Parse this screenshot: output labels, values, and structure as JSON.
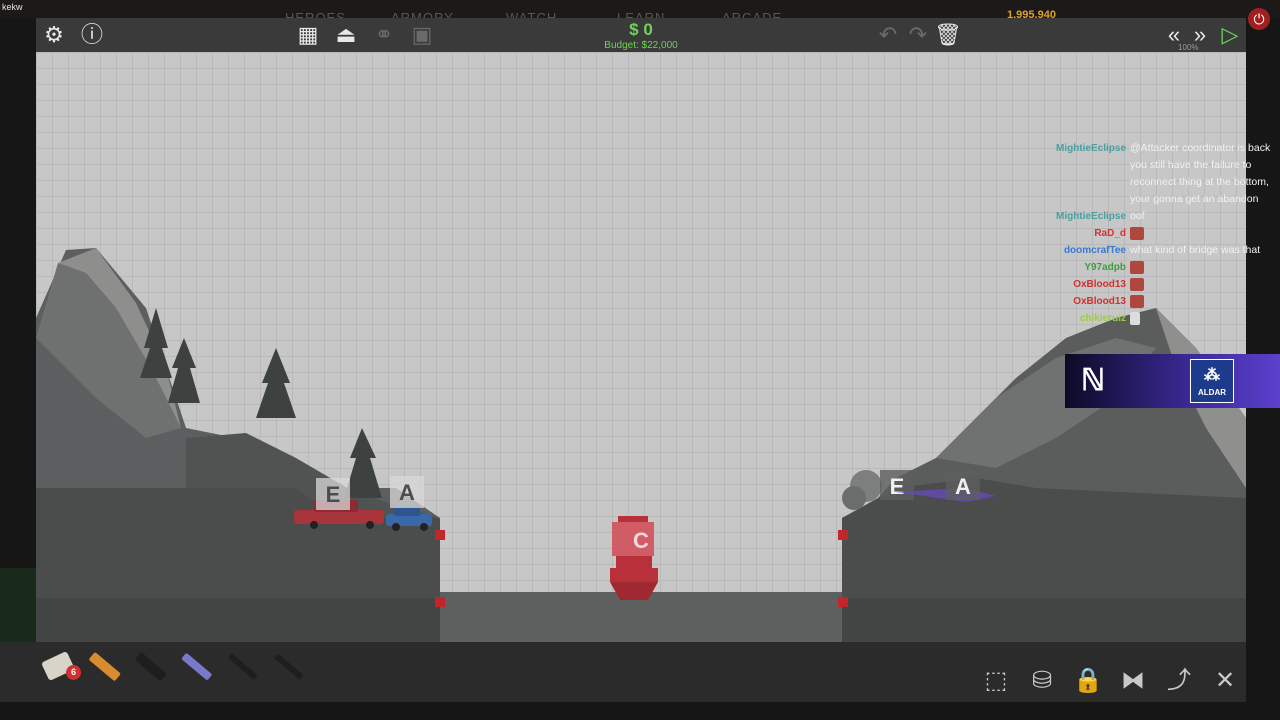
{
  "stream": {
    "label": "kekw",
    "nav": [
      "HEROES",
      "ARMORY",
      "WATCH",
      "LEARN",
      "ARCADE"
    ],
    "coins": "1,995,940"
  },
  "toolbar": {
    "money": "$ 0",
    "budget": "Budget: $22,000",
    "speed": "100%",
    "icons_left": [
      "gear-icon",
      "info-icon"
    ],
    "icons_center": [
      "bridge-layers-icon",
      "weight-icon",
      "bike-icon",
      "camera-icon"
    ],
    "icons_right": [
      "undo-icon",
      "redo-icon",
      "trash-icon",
      "rewind-icon",
      "fast-forward-icon",
      "play-icon"
    ]
  },
  "scene": {
    "left_markers": [
      "E",
      "A"
    ],
    "right_markers": [
      "E",
      "A"
    ],
    "checkpoint": "C",
    "colors": {
      "anchor": "#c0262c",
      "checkpoint": "#b8303a",
      "money": "#6fd35a"
    }
  },
  "materials": {
    "road_count": "6",
    "items": [
      "road-material-icon",
      "wood-material-icon",
      "steel-material-icon",
      "hydraulic-material-icon",
      "rope-material-icon",
      "cable-material-icon"
    ]
  },
  "tools": [
    "select-area-icon",
    "paint-icon",
    "lock-icon",
    "mirror-icon",
    "spline-icon",
    "close-icon"
  ],
  "chat": [
    {
      "user": "MightieEclipse",
      "color": "#4aa0a0",
      "msg": "@Attacker coordinator is back you still have the failure to reconnect thing at the bottom, your gonna get an abandon"
    },
    {
      "user": "MightieEclipse",
      "color": "#4aa0a0",
      "msg": "oof"
    },
    {
      "user": "RaD_d",
      "color": "#d83030",
      "msg": ""
    },
    {
      "user": "doomcrafTee",
      "color": "#3a7ad0",
      "msg": "what kind of bridge was that"
    },
    {
      "user": "Y97adpb",
      "color": "#3aa03a",
      "msg": ""
    },
    {
      "user": "OxBlood13",
      "color": "#d03030",
      "msg": ""
    },
    {
      "user": "OxBlood13",
      "color": "#d03030",
      "msg": ""
    },
    {
      "user": "chikieruiz",
      "color": "#9ad040",
      "msg": ""
    }
  ],
  "sponsor": {
    "brand": "ALDAR"
  }
}
